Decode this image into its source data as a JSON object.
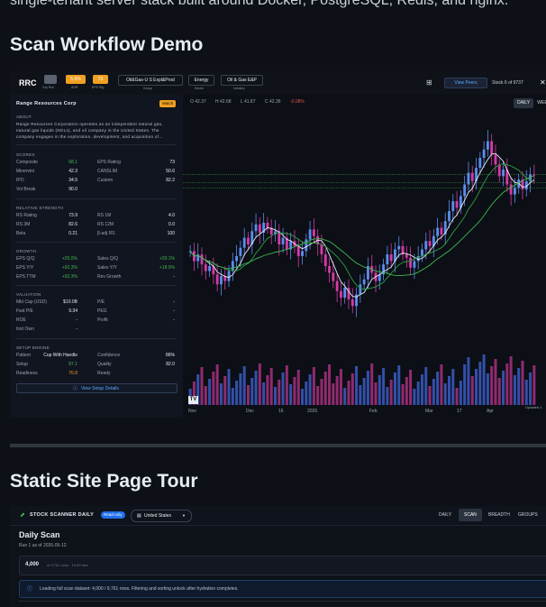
{
  "intro_text": "single-tenant server stack built around Docker, PostgreSQL, Redis, and nginx.",
  "section1_title": "Scan Workflow Demo",
  "section2_title": "Static Site Page Tour",
  "shot1": {
    "ticker": "RRC",
    "pills": [
      {
        "value": "",
        "caption": "Grp Rnk"
      },
      {
        "value": "5.5%",
        "caption": "ADR"
      },
      {
        "value": "73",
        "caption": "EPS Rtg"
      }
    ],
    "tags": [
      {
        "value": "Oil&Gas-U S Expl&Prod",
        "caption": "Group"
      },
      {
        "value": "Energy",
        "caption": "Sector"
      },
      {
        "value": "Oil & Gas E&P",
        "caption": "Industry"
      }
    ],
    "view_peers": "View Peers",
    "stock_count": "Stock 6 of 9737",
    "close_glyph": "✕",
    "ohlc": {
      "o": "O 42.37",
      "h": "H 42.68",
      "l": "L 41.87",
      "c": "C 42.36",
      "chg": "-0.08%"
    },
    "timeframes": [
      "DAILY",
      "WEE"
    ],
    "company": "Range Resources Corp",
    "watch_label": "Watch",
    "about_heading": "ABOUT",
    "about_text": [
      "Range Resources Corporation operates as an independent natural gas,",
      "natural gas liquids (NGLs), and oil company in the United States. The",
      "company engages in the exploration, development, and acquisition of..."
    ],
    "scores_heading": "SCORES",
    "scores": [
      {
        "label": "Composite",
        "value": "68.1",
        "label2": "EPS Rating",
        "value2": "73"
      },
      {
        "label": "Minervini",
        "value": "42.3",
        "label2": "CANSLIM",
        "value2": "50.6"
      },
      {
        "label": "IPO",
        "value": "34.5",
        "label2": "Custom",
        "value2": "82.2"
      },
      {
        "label": "Vol Break",
        "value": "90.0",
        "label2": "",
        "value2": ""
      }
    ],
    "rs_heading": "RELATIVE STRENGTH",
    "rs": [
      {
        "label": "RS Rating",
        "value": "73.9",
        "label2": "RS 1M",
        "value2": "4.0"
      },
      {
        "label": "RS 3M",
        "value": "82.6",
        "label2": "RS 12M",
        "value2": "0.0"
      },
      {
        "label": "Beta",
        "value": "0.21",
        "label2": "β-adj RS",
        "value2": "100"
      }
    ],
    "growth_heading": "GROWTH",
    "growth": [
      {
        "label": "EPS Q/Q",
        "value": "+25.0%",
        "label2": "Sales Q/Q",
        "value2": "+20.1%"
      },
      {
        "label": "EPS Y/Y",
        "value": "+92.3%",
        "label2": "Sales Y/Y",
        "value2": "+18.0%"
      },
      {
        "label": "EPS TTM",
        "value": "+92.3%",
        "label2": "Rev Growth",
        "value2": "-"
      }
    ],
    "valuation_heading": "VALUATION",
    "valuation": [
      {
        "label": "Mkt Cap (USD)",
        "value": "$10.0B",
        "label2": "P/E",
        "value2": "-"
      },
      {
        "label": "Fwd P/E",
        "value": "9.34",
        "label2": "PEG",
        "value2": "-"
      },
      {
        "label": "ROE",
        "value": "-",
        "label2": "Profit",
        "value2": "-"
      },
      {
        "label": "Inst Own",
        "value": "-",
        "label2": "",
        "value2": ""
      }
    ],
    "setup_heading": "SETUP ENGINE",
    "setup": [
      {
        "label": "Pattern",
        "value": "Cup With Handle",
        "label2": "Confidence",
        "value2": "86%"
      },
      {
        "label": "Setup",
        "value": "87.1",
        "label2": "Quality",
        "value2": "82.0"
      },
      {
        "label": "Readiness",
        "value": "76.8",
        "label2": "Ready",
        "value2": ""
      }
    ],
    "view_setup": "View Setup Details",
    "x_labels": [
      "Nov",
      "Dec",
      "16",
      "2026",
      "Feb",
      "Mar",
      "17",
      "Apr"
    ],
    "updated_label": "Updated 1",
    "tv_logo": "TV",
    "y_axis_right": [
      "4",
      "4",
      "4",
      "4",
      "4",
      "4",
      "4",
      "4",
      "4",
      "3",
      "3",
      "3",
      "3",
      "3",
      "3",
      "3",
      "3",
      "3"
    ]
  },
  "shot2": {
    "brand": "STOCK SCANNER DAILY",
    "badge": "Read-only",
    "region": "United States",
    "nav": [
      "DAILY",
      "SCAN",
      "BREADTH",
      "GROUPS"
    ],
    "title": "Daily Scan",
    "subtitle": "Run 1 as of 2026-05-12.",
    "count": "4,000",
    "count_note": "of 9,761 rows · 13.89 dwn",
    "notice": "Loading full scan dataset: 4,000 / 9,761 rows. Filtering and sorting unlock after hydration completes."
  },
  "chart_data": {
    "type": "candlestick",
    "x_ticks": [
      "Nov",
      "Dec",
      "16",
      "2026",
      "Feb",
      "Mar",
      "17",
      "Apr"
    ],
    "y_range": [
      33,
      46
    ],
    "note": "Daily candles with volume bars and three moving-average lines; values estimated visually.",
    "closes": [
      37.8,
      37.2,
      37.6,
      37.0,
      36.6,
      36.9,
      36.4,
      35.8,
      36.3,
      36.0,
      36.6,
      37.2,
      37.5,
      38.0,
      38.6,
      38.2,
      39.0,
      39.4,
      38.9,
      39.5,
      39.2,
      38.8,
      39.0,
      38.2,
      38.6,
      37.9,
      38.4,
      38.1,
      37.5,
      37.8,
      38.5,
      39.1,
      38.7,
      38.2,
      37.6,
      36.9,
      36.5,
      36.0,
      35.4,
      35.0,
      35.6,
      34.9,
      34.5,
      35.2,
      35.8,
      36.1,
      36.9,
      36.5,
      36.0,
      36.4,
      37.0,
      37.6,
      37.2,
      37.9,
      38.1,
      37.6,
      37.4,
      36.8,
      37.2,
      37.5,
      37.9,
      38.4,
      38.1,
      38.7,
      39.2,
      38.8,
      39.6,
      40.2,
      40.8,
      40.4,
      41.1,
      41.8,
      42.5,
      42.0,
      42.8,
      43.4,
      43.9,
      44.4,
      43.6,
      43.0,
      42.3,
      42.7,
      41.8,
      41.2,
      41.6,
      42.1,
      41.5,
      42.0,
      42.4,
      42.36
    ]
  }
}
